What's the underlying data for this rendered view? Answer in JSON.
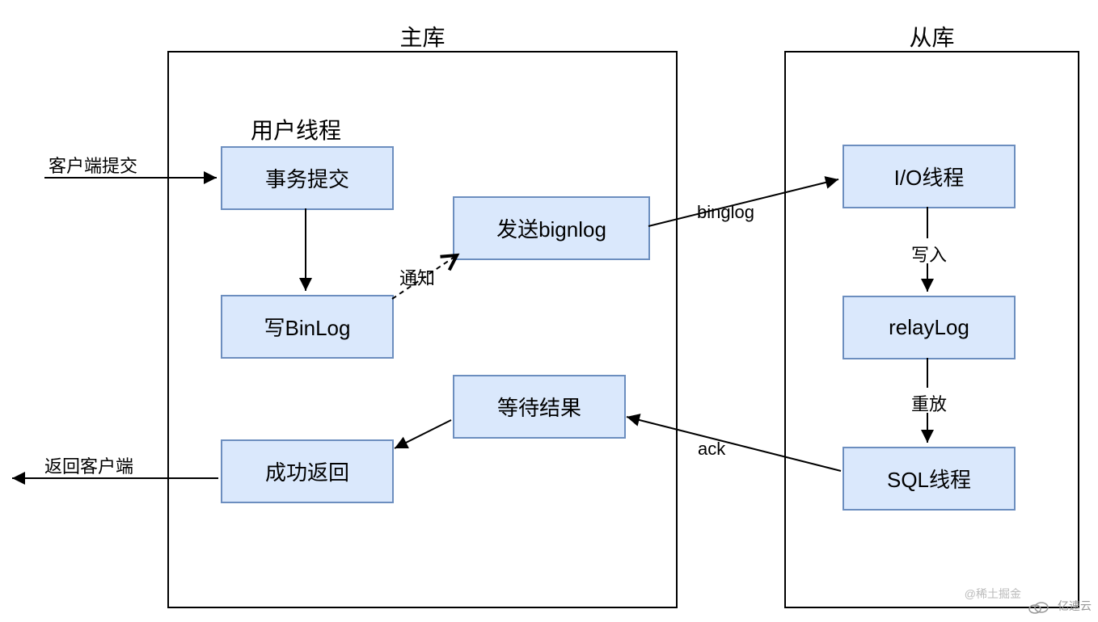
{
  "master": {
    "title": "主库",
    "userThreadLabel": "用户线程",
    "boxes": {
      "txCommit": "事务提交",
      "writeBinLog": "写BinLog",
      "sendBinlog": "发送bignlog",
      "waitResult": "等待结果",
      "successReturn": "成功返回"
    }
  },
  "slave": {
    "title": "从库",
    "boxes": {
      "ioThread": "I/O线程",
      "relayLog": "relayLog",
      "sqlThread": "SQL线程"
    }
  },
  "edges": {
    "clientSubmit": "客户端提交",
    "notify": "通知",
    "binglog": "binglog",
    "write": "写入",
    "replay": "重放",
    "ack": "ack",
    "returnClient": "返回客户端"
  },
  "watermarks": {
    "xitu": "@稀土掘金",
    "yisu": "亿速云"
  }
}
